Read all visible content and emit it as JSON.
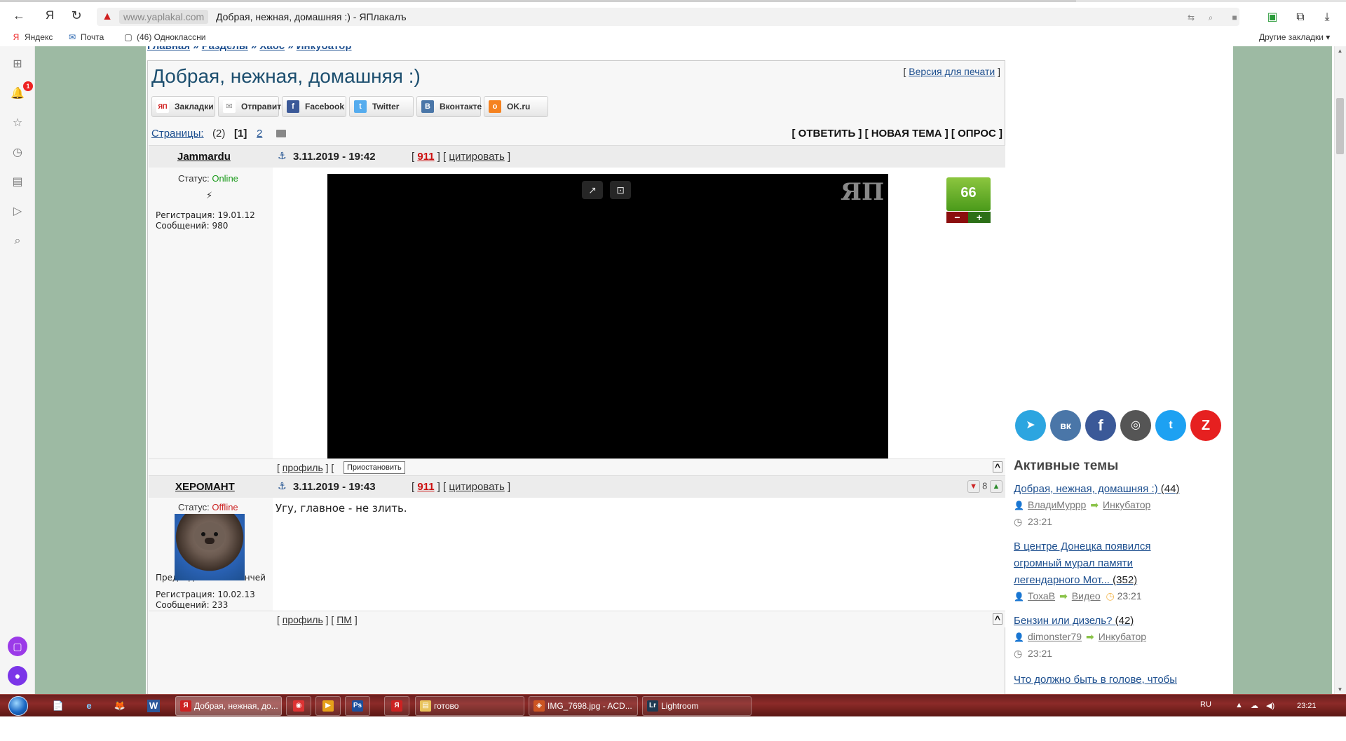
{
  "browser": {
    "back_icon": "←",
    "yandex_icon": "Я",
    "reload_icon": "↻",
    "warning_icon": "▲",
    "url_domain": "www.yaplakal.com",
    "page_title": "Добрая, нежная, домашняя :) - ЯПлакалъ",
    "url_tools": [
      "translate-icon",
      "zoom-icon",
      "bookmark-icon"
    ],
    "ext_icons": [
      "extension-icon",
      "collections-icon",
      "download-icon"
    ],
    "bookmarks": [
      {
        "icon": "Я",
        "label": "Яндекс"
      },
      {
        "icon": "✉",
        "label": "Почта"
      },
      {
        "icon": "▢",
        "label": "(46) Одноклассни"
      }
    ],
    "other_bookmarks": "Другие закладки ▾"
  },
  "side_panel": {
    "items": [
      "apps-icon",
      "notifications-icon",
      "favorites-icon",
      "history-icon",
      "collections-icon",
      "video-icon",
      "search-icon"
    ],
    "badge": "1"
  },
  "crumbs": [
    "Главная",
    "Разделы",
    "Хаос",
    "Инкубатор"
  ],
  "topic": {
    "title": "Добрая, нежная, домашняя :)",
    "print_prefix": "[ ",
    "print_link": "Версия для печати",
    "print_suffix": " ]"
  },
  "share": [
    {
      "icon": "ЯП",
      "label": "Закладки",
      "color": "#cc1111"
    },
    {
      "icon": "✉",
      "label": "Отправить",
      "color": "#888888"
    },
    {
      "icon": "f",
      "label": "Facebook",
      "color": "#3b5998"
    },
    {
      "icon": "t",
      "label": "Twitter",
      "color": "#55acee"
    },
    {
      "icon": "В",
      "label": "Вконтакте",
      "color": "#4a76a8"
    },
    {
      "icon": "о",
      "label": "OK.ru",
      "color": "#f58220"
    }
  ],
  "pages": {
    "label": "Страницы:",
    "count": "(2)",
    "current": "[1]",
    "next": "2",
    "actions": "[ ОТВЕТИТЬ ] [ НОВАЯ ТЕМА ] [ ОПРОС ]"
  },
  "posts": [
    {
      "author": "Jammardu",
      "anchor": "⚓",
      "date": "3.11.2019 - 19:42",
      "num": "911",
      "cite": "цитировать",
      "status_label": "Статус: ",
      "status": "Online",
      "symbol": "⚡",
      "reg": "Регистрация: 19.01.12",
      "msgs": "Сообщений: 980",
      "rating": "66",
      "rating_minus": "−",
      "rating_plus": "+",
      "video_logo": "ЯП",
      "video_btn1": "↗",
      "video_btn2": "⊡",
      "foot_profile": "профиль",
      "tooltip": "Приостановить",
      "up": "^"
    },
    {
      "author": "ХЕРОМАНТ",
      "anchor": "⚓",
      "date": "3.11.2019 - 19:43",
      "num": "911",
      "cite": "цитировать",
      "status_label": "Статус: ",
      "status": "Offline",
      "caption": "Предводитель команчей",
      "reg": "Регистрация: 10.02.13",
      "msgs": "Сообщений: 233",
      "text": "Угу, главное - не злить.",
      "rate_value": "8",
      "foot_profile": "профиль",
      "foot_pm": "ПМ",
      "up": "^"
    }
  ],
  "right": {
    "socials": [
      {
        "name": "telegram",
        "glyph": "➤",
        "color": "#2ca5e0"
      },
      {
        "name": "vk",
        "glyph": "вк",
        "color": "#4a76a8"
      },
      {
        "name": "facebook",
        "glyph": "f",
        "color": "#3b5998"
      },
      {
        "name": "instagram",
        "glyph": "◎",
        "color": "#555555"
      },
      {
        "name": "twitter",
        "glyph": "t",
        "color": "#1da1f2"
      },
      {
        "name": "zen",
        "glyph": "Z",
        "color": "#e62020"
      }
    ],
    "active_title": "Активные темы",
    "topics": [
      {
        "title": "Добрая, нежная, домашняя :)",
        "count": "(44)",
        "user": "ВладиМуррр",
        "section": "Инкубатор",
        "time": "23:21"
      },
      {
        "title": "В центре Донецка появился огромный мурал памяти легендарного Мот...",
        "count": "(352)",
        "user": "ТохаВ",
        "section": "Видео",
        "time": "23:21"
      },
      {
        "title": "Бензин или дизель?",
        "count": "(42)",
        "user": "dimonster79",
        "section": "Инкубатор",
        "time": "23:21"
      },
      {
        "title": "Что должно быть в голове, чтобы"
      }
    ]
  },
  "taskbar": {
    "quick": [
      "📄",
      "e",
      "🦊",
      "W",
      "▣"
    ],
    "tasks": [
      {
        "label": "Добрая, нежная, до...",
        "icon": "Я",
        "color": "#cc2222",
        "active": true
      },
      {
        "label": "",
        "icon": "◉",
        "color": "#d33"
      },
      {
        "label": "",
        "icon": "▶",
        "color": "#e6a11a"
      },
      {
        "label": "",
        "icon": "Ps",
        "color": "#1c4f9c"
      },
      {
        "label": "",
        "icon": "Я",
        "color": "#cc2222"
      },
      {
        "label": "готово",
        "icon": "▤",
        "color": "#e8c25a"
      },
      {
        "label": "IMG_7698.jpg - ACD...",
        "icon": "◈",
        "color": "#cc5522"
      },
      {
        "label": "Lightroom",
        "icon": "Lr",
        "color": "#1f3a52"
      }
    ],
    "lang": "RU",
    "tray": [
      "▲",
      "☁",
      "◀)"
    ],
    "clock": "23:21"
  }
}
